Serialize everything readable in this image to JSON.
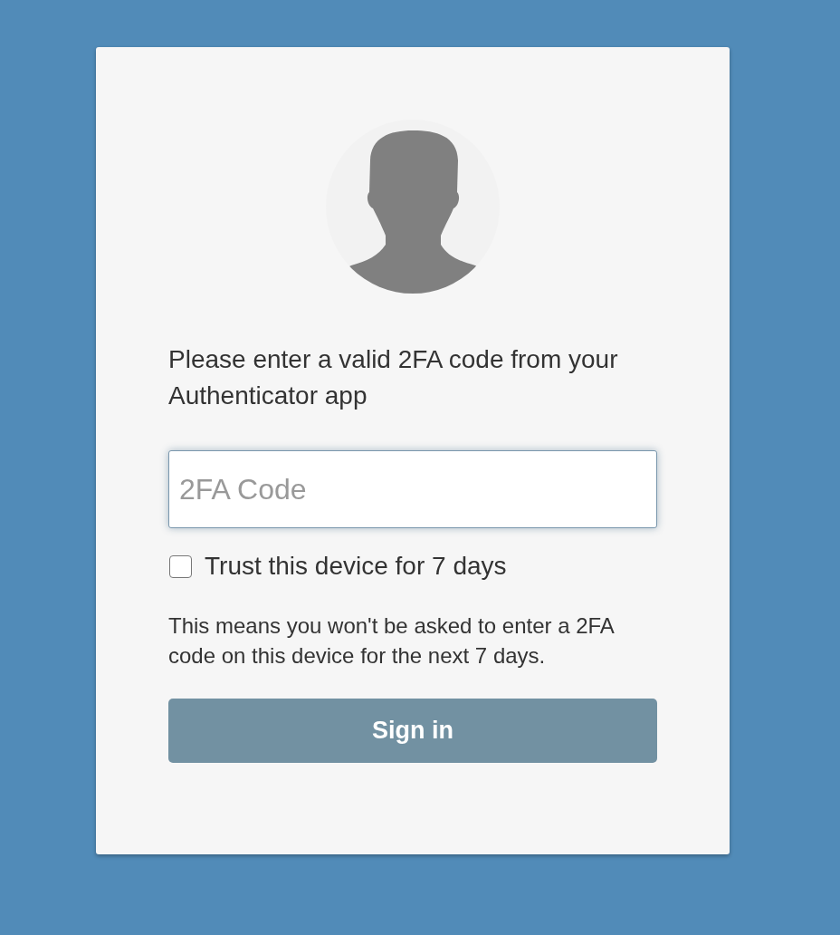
{
  "prompt": "Please enter a valid 2FA code from your Authenticator app",
  "code_field": {
    "placeholder": "2FA Code"
  },
  "trust_device": {
    "label": "Trust this device for 7 days",
    "checked": false
  },
  "note": "This means you won't be asked to enter a 2FA code on this device for the next 7 days.",
  "sign_in_button": {
    "label": "Sign in"
  }
}
